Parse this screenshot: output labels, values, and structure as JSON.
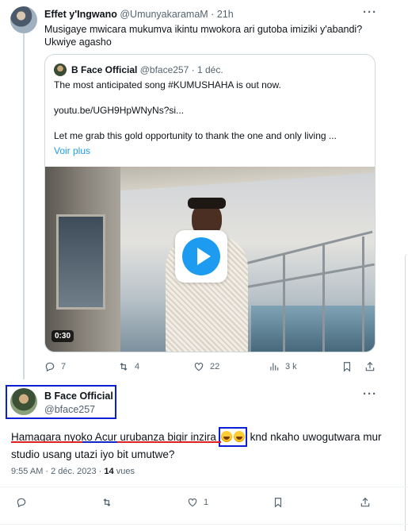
{
  "top_tweet": {
    "name": "Effet y'Ingwano",
    "handle": "@UmunyakaramaM",
    "dot": "·",
    "time": "21h",
    "text": "Musigaye mwicara mukumva ikintu mwokora ari gutoba imiziki y'abandi? Ukwiye agasho"
  },
  "quote": {
    "name": "B Face Official",
    "handle": "@bface257",
    "dot": "·",
    "time": "1 déc.",
    "lines": [
      "The most anticipated song #KUMUSHAHA is out now.",
      "youtu.be/UGH9HpWNyNs?si...",
      "Let me grab this gold opportunity to thank the one and only living ..."
    ],
    "show_more": "Voir plus",
    "video_duration": "0:30"
  },
  "top_actions": {
    "replies": "7",
    "reposts": "4",
    "likes": "22",
    "views": "3 k"
  },
  "main_tweet": {
    "name": "B Face Official",
    "handle": "@bface257",
    "text_part1": "Hamagara nyoko Acur urubanza bigir inzira",
    "text_part2": " knd nkaho uwogutwara mur studio usang utazi iyo bit umutwe?",
    "time": "9:55 AM · 2 déc. 2023 ·",
    "views_count": "14",
    "views_label": "vues",
    "likes": "1"
  },
  "colors": {
    "accent": "#1d9bf0",
    "highlight_box": "#0a1fd6",
    "underline_red": "#e02020",
    "underline_blue": "#1226c8"
  }
}
